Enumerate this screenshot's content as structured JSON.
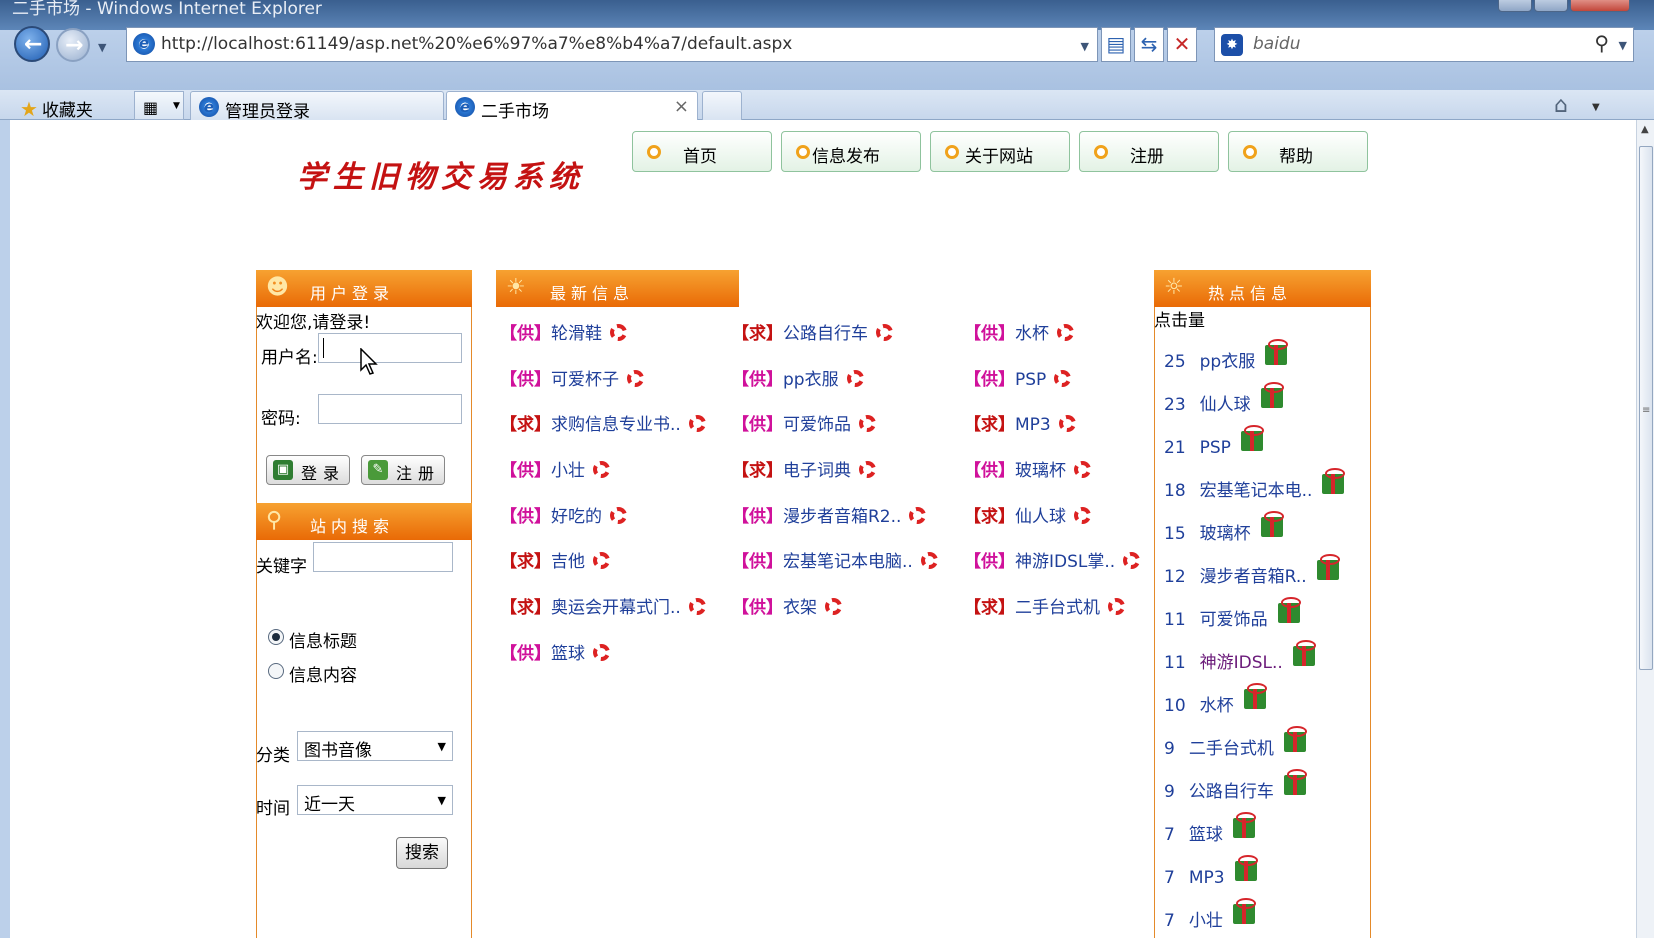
{
  "window": {
    "title": "二手市场 - Windows Internet Explorer"
  },
  "address": {
    "url": "http://localhost:61149/asp.net%20%e6%97%a7%e8%b4%a7/default.aspx",
    "url_host": "localhost"
  },
  "search": {
    "placeholder": "baidu"
  },
  "favorites": {
    "label": "收藏夹"
  },
  "tabs": [
    {
      "label": "管理员登录"
    },
    {
      "label": "二手市场",
      "close": "×"
    }
  ],
  "site": {
    "logo": "学生旧物交易系统",
    "nav": [
      "首页",
      "信息发布",
      "关于网站",
      "注册",
      "帮助"
    ]
  },
  "login": {
    "header": "用户登录",
    "welcome": "欢迎您,请登录!",
    "username_label": "用户名:",
    "password_label": "密码:",
    "login_btn": "登录",
    "register_btn": "注册"
  },
  "site_search": {
    "header": "站内搜索",
    "keyword_label": "关键字",
    "radio_title": "信息标题",
    "radio_content": "信息内容",
    "category_label": "分类",
    "category_value": "图书音像",
    "time_label": "时间",
    "time_value": "近一天",
    "submit": "搜索"
  },
  "latest": {
    "header": "最新信息",
    "items": [
      {
        "tag": "【供】",
        "type": "gong",
        "title": "轮滑鞋"
      },
      {
        "tag": "【求】",
        "type": "qiu",
        "title": "公路自行车"
      },
      {
        "tag": "【供】",
        "type": "gong",
        "title": "水杯"
      },
      {
        "tag": "【供】",
        "type": "gong",
        "title": "可爱杯子"
      },
      {
        "tag": "【供】",
        "type": "gong",
        "title": "pp衣服"
      },
      {
        "tag": "【供】",
        "type": "gong",
        "title": "PSP"
      },
      {
        "tag": "【求】",
        "type": "qiu",
        "title": "求购信息专业书.."
      },
      {
        "tag": "【供】",
        "type": "gong",
        "title": "可爱饰品"
      },
      {
        "tag": "【求】",
        "type": "qiu",
        "title": "MP3"
      },
      {
        "tag": "【供】",
        "type": "gong",
        "title": "小壮"
      },
      {
        "tag": "【求】",
        "type": "qiu",
        "title": "电子词典"
      },
      {
        "tag": "【供】",
        "type": "gong",
        "title": "玻璃杯"
      },
      {
        "tag": "【供】",
        "type": "gong",
        "title": "好吃的"
      },
      {
        "tag": "【供】",
        "type": "gong",
        "title": "漫步者音箱R2.."
      },
      {
        "tag": "【求】",
        "type": "qiu",
        "title": "仙人球"
      },
      {
        "tag": "【求】",
        "type": "qiu",
        "title": "吉他"
      },
      {
        "tag": "【供】",
        "type": "gong",
        "title": "宏基笔记本电脑.."
      },
      {
        "tag": "【供】",
        "type": "gong",
        "title": "神游IDSL掌.."
      },
      {
        "tag": "【求】",
        "type": "qiu",
        "title": "奥运会开幕式门.."
      },
      {
        "tag": "【供】",
        "type": "gong",
        "title": "衣架"
      },
      {
        "tag": "【求】",
        "type": "qiu",
        "title": "二手台式机"
      },
      {
        "tag": "【供】",
        "type": "gong",
        "title": "篮球"
      }
    ]
  },
  "hot": {
    "header": "热点信息",
    "clicks_label": "点击量",
    "items": [
      {
        "count": "25",
        "title": "pp衣服"
      },
      {
        "count": "23",
        "title": "仙人球"
      },
      {
        "count": "21",
        "title": "PSP"
      },
      {
        "count": "18",
        "title": "宏基笔记本电.."
      },
      {
        "count": "15",
        "title": "玻璃杯"
      },
      {
        "count": "12",
        "title": "漫步者音箱R.."
      },
      {
        "count": "11",
        "title": "可爱饰品"
      },
      {
        "count": "11",
        "title": "神游IDSL..",
        "visited": true
      },
      {
        "count": "10",
        "title": "水杯"
      },
      {
        "count": "9",
        "title": "二手台式机"
      },
      {
        "count": "9",
        "title": "公路自行车"
      },
      {
        "count": "7",
        "title": "篮球"
      },
      {
        "count": "7",
        "title": "MP3"
      },
      {
        "count": "7",
        "title": "小壮"
      }
    ]
  },
  "colors": {
    "gong_tag": "#d0119b",
    "qiu_tag": "#c41212",
    "link": "#1f3f9a",
    "panel_header": "#ef7f14"
  }
}
